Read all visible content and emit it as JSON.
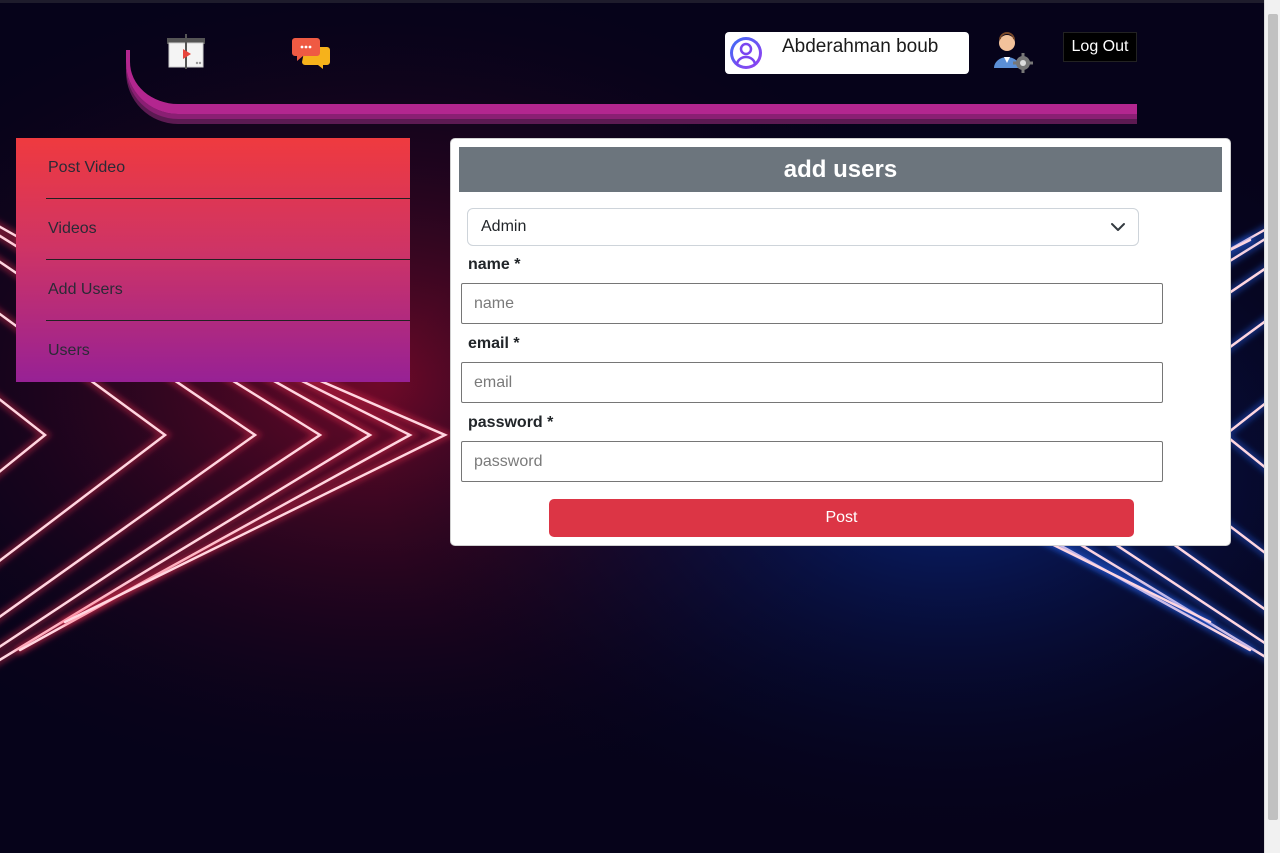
{
  "header": {
    "user_name": "Abderahman boub",
    "logout_label": "Log Out",
    "icons": [
      "video-board-icon",
      "chat-icon",
      "user-avatar-icon",
      "admin-settings-icon"
    ]
  },
  "sidebar": {
    "items": [
      {
        "label": "Post Video"
      },
      {
        "label": "Videos"
      },
      {
        "label": "Add Users"
      },
      {
        "label": "Users"
      }
    ]
  },
  "form": {
    "title": "add users",
    "role_selected": "Admin",
    "fields": {
      "name": {
        "label": "name *",
        "placeholder": "name"
      },
      "email": {
        "label": "email *",
        "placeholder": "email"
      },
      "password": {
        "label": "password *",
        "placeholder": "password"
      }
    },
    "submit_label": "Post"
  },
  "colors": {
    "accent_red": "#dc3545",
    "card_header": "#6c757d",
    "sidebar_top": "#ef3a3f",
    "sidebar_bottom": "#972195",
    "header_stripe": "#b3268f",
    "neon_red": "#ff3355",
    "neon_blue": "#2f6bff"
  }
}
